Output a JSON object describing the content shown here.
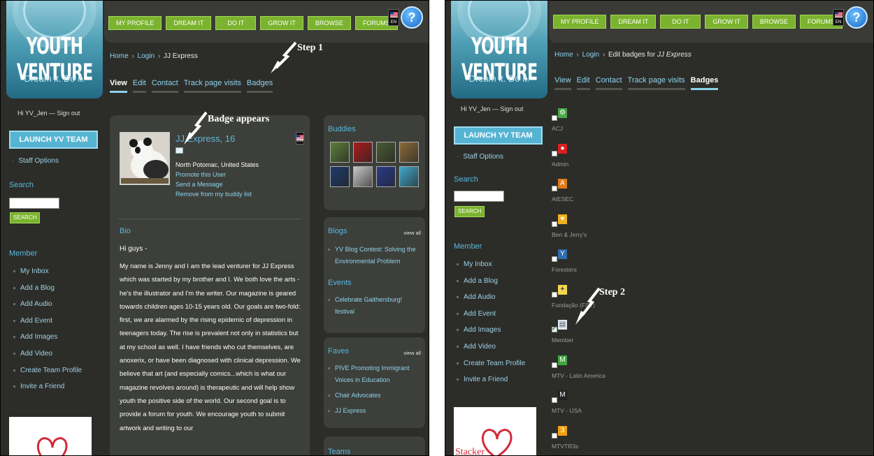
{
  "colors": {
    "accent_green": "#7bb32e",
    "accent_blue": "#58b8dd",
    "link_blue": "#8fd3ee",
    "panel_bg": "#2c2d29",
    "card_bg": "#3d3f3a"
  },
  "brand": {
    "title": "YOUTH VENTURE",
    "tagline": "Dream it. Do it."
  },
  "nav": [
    "MY PROFILE",
    "DREAM IT",
    "DO IT",
    "GROW IT",
    "BROWSE",
    "FORUMS"
  ],
  "lang_label": "EN",
  "help_icon": "?",
  "sidebar": {
    "greeting": "Hi YV_Jen",
    "dash": " — ",
    "signout": "Sign out",
    "launch": "LAUNCH YV TEAM",
    "staff": "Staff Options",
    "search_head": "Search",
    "search_button": "SEARCH",
    "member_head": "Member",
    "member_links": [
      "My Inbox",
      "Add a Blog",
      "Add Audio",
      "Add Event",
      "Add Images",
      "Add Video",
      "Create Team Profile",
      "Invite a Friend"
    ],
    "ad_text": "Stacker"
  },
  "left": {
    "breadcrumb": {
      "home": "Home",
      "sep": " › ",
      "login": "Login",
      "current": "JJ Express"
    },
    "tabs": [
      "View",
      "Edit",
      "Contact",
      "Track page visits",
      "Badges"
    ],
    "step_label": "Step 1",
    "badge_label": "Badge appears",
    "profile": {
      "name": "JJ Express, 16",
      "location": "North Potomac, United States",
      "links": [
        "Promote this User",
        "Send a Message",
        "Remove from my buddy list"
      ]
    },
    "bio": {
      "head": "Bio",
      "greeting": "Hi guys -",
      "text": "My name is Jenny and I am the lead venturer for JJ Express which was started by my brother and I. We both love the arts - he's the illustrator and I'm the writer. Our magazine is geared towards children ages 10-15 years old. Our goals are two-fold: first, we are alarmed by the rising epidemic of depression in teenagers today. The rise is prevalent not only in statistics but at my school as well. I have friends who cut themselves, are anoxerix, or have been diagnosed with clinical depression. We believe that art (and especially comics...which is what our magazine revolves around) is therapeutic and will help show youth the positive side of the world. Our second goal is to provide a forum for youth. We encourage youth to submit artwork and writing to our"
    },
    "buddies": {
      "head": "Buddies",
      "colors": [
        "#5d7d3a",
        "#a81d1d",
        "#4a5a34",
        "#8a6a3a",
        "#1e3a6a",
        "#c8c8c8",
        "#2a3a8a",
        "#3fa6c8"
      ]
    },
    "blogs": {
      "head": "Blogs",
      "view_all": "view all",
      "items": [
        "YV Blog Contest: Solving the Environmental Problem"
      ]
    },
    "events": {
      "head": "Events",
      "items": [
        "Celebrate Gaithersburg! festival"
      ]
    },
    "faves": {
      "head": "Faves",
      "view_all": "view all",
      "items": [
        "PIVE Promoting Immigrant Voices in Education",
        "Chair Advocates",
        "JJ Express"
      ]
    },
    "teams": {
      "head": "Teams"
    }
  },
  "right": {
    "breadcrumb": {
      "home": "Home",
      "sep": " › ",
      "login": "Login",
      "prefix": "Edit badges for ",
      "current": "JJ Express"
    },
    "tabs": [
      "View",
      "Edit",
      "Contact",
      "Track page visits",
      "Badges"
    ],
    "step_label": "Step 2",
    "badges": [
      {
        "label": "ACJ",
        "checked": false,
        "color": "#4aa84a",
        "glyph": "⚙"
      },
      {
        "label": "Admin",
        "checked": false,
        "color": "#d8201e",
        "glyph": "●"
      },
      {
        "label": "AIESEC",
        "checked": false,
        "color": "#e07a18",
        "glyph": "A"
      },
      {
        "label": "Ben & Jerry's",
        "checked": false,
        "color": "#f0b020",
        "glyph": "♥"
      },
      {
        "label": "Foresters",
        "checked": false,
        "color": "#2d6db0",
        "glyph": "Y"
      },
      {
        "label": "Fundação   (FST)",
        "checked": false,
        "color": "#f4d64a",
        "glyph": "✦"
      },
      {
        "label": "Member",
        "checked": true,
        "color": "#dfe6f0",
        "glyph": "▤"
      },
      {
        "label": "MTV - Latin America",
        "checked": false,
        "color": "#3fa83f",
        "glyph": "M"
      },
      {
        "label": "MTV - USA",
        "checked": false,
        "color": "#222222",
        "glyph": "M"
      },
      {
        "label": "MTVTR3s",
        "checked": false,
        "color": "#f0a010",
        "glyph": "3"
      }
    ]
  }
}
